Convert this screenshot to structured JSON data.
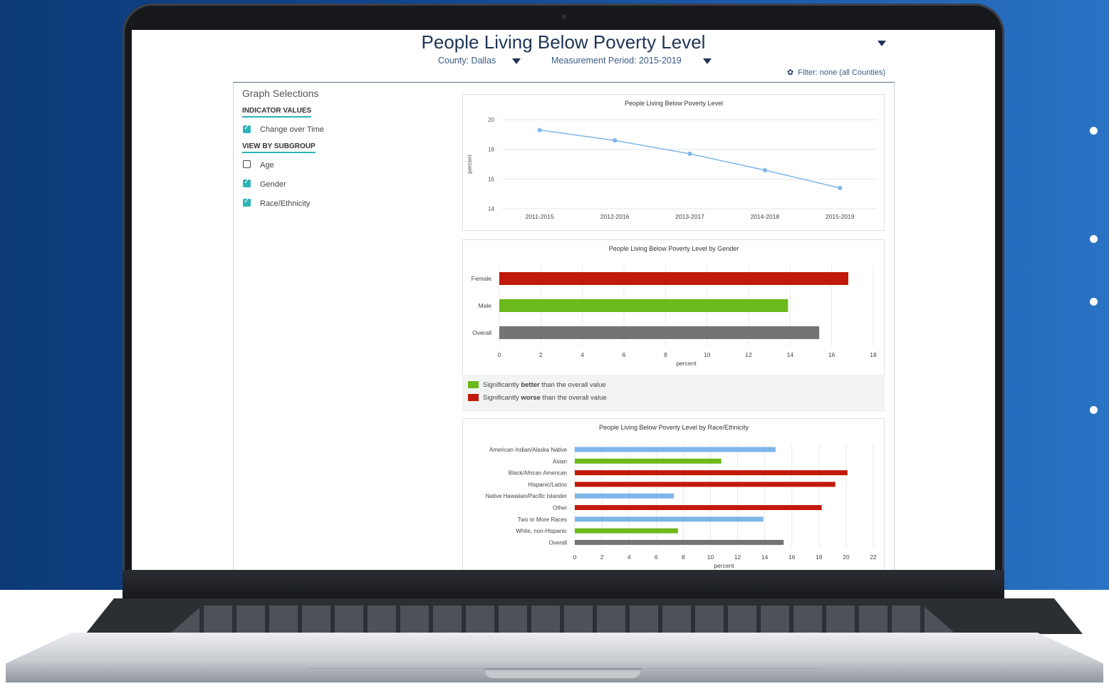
{
  "page": {
    "title": "People Living Below Poverty Level",
    "county_label": "County: Dallas",
    "period_label": "Measurement Period: 2015-2019",
    "filter_label": "Filter: none (all Counties)"
  },
  "graph_selections": {
    "title": "Graph Selections",
    "indicator_header": "INDICATOR VALUES",
    "indicator_items": [
      {
        "label": "Change over Time",
        "checked": true
      }
    ],
    "subgroup_header": "VIEW BY SUBGROUP",
    "subgroup_items": [
      {
        "label": "Age",
        "checked": false
      },
      {
        "label": "Gender",
        "checked": true
      },
      {
        "label": "Race/Ethnicity",
        "checked": true
      }
    ]
  },
  "legend": {
    "better_pre": "Significantly ",
    "better_bold": "better",
    "better_post": " than the overall value",
    "worse_pre": "Significantly ",
    "worse_bold": "worse",
    "worse_post": " than the overall value",
    "better_color": "#6cb91b",
    "worse_color": "#c11a0a"
  },
  "colors": {
    "overall": "#747474",
    "neutral": "#7db6e8",
    "line": "#7db6e8"
  },
  "chart_data": [
    {
      "type": "line",
      "title": "People Living Below Poverty Level",
      "ylabel": "percent",
      "x": [
        "2011-2015",
        "2012-2016",
        "2013-2017",
        "2014-2018",
        "2015-2019"
      ],
      "y": [
        19.3,
        18.6,
        17.7,
        16.6,
        15.4
      ],
      "ylim": [
        14,
        20
      ],
      "yticks": [
        14,
        16,
        18,
        20
      ]
    },
    {
      "type": "bar",
      "title": "People Living Below Poverty Level by Gender",
      "xlabel": "percent",
      "categories": [
        "Female",
        "Male",
        "Overall"
      ],
      "values": [
        16.8,
        13.9,
        15.4
      ],
      "status": [
        "worse",
        "better",
        "overall"
      ],
      "xlim": [
        0,
        18
      ],
      "xticks": [
        0,
        2,
        4,
        6,
        8,
        10,
        12,
        14,
        16,
        18
      ]
    },
    {
      "type": "bar",
      "title": "People Living Below Poverty Level by Race/Ethnicity",
      "xlabel": "percent",
      "categories": [
        "American Indian/Alaska Native",
        "Asian",
        "Black/African American",
        "Hispanic/Latino",
        "Native Hawaiian/Pacific Islander",
        "Other",
        "Two or More Races",
        "White, non-Hispanic",
        "Overall"
      ],
      "values": [
        14.8,
        10.8,
        20.1,
        19.2,
        7.3,
        18.2,
        13.9,
        7.6,
        15.4
      ],
      "status": [
        "neutral",
        "better",
        "worse",
        "worse",
        "neutral",
        "worse",
        "neutral",
        "better",
        "overall"
      ],
      "xlim": [
        0,
        22
      ],
      "xticks": [
        0,
        2,
        4,
        6,
        8,
        10,
        12,
        14,
        16,
        18,
        20,
        22
      ]
    }
  ]
}
